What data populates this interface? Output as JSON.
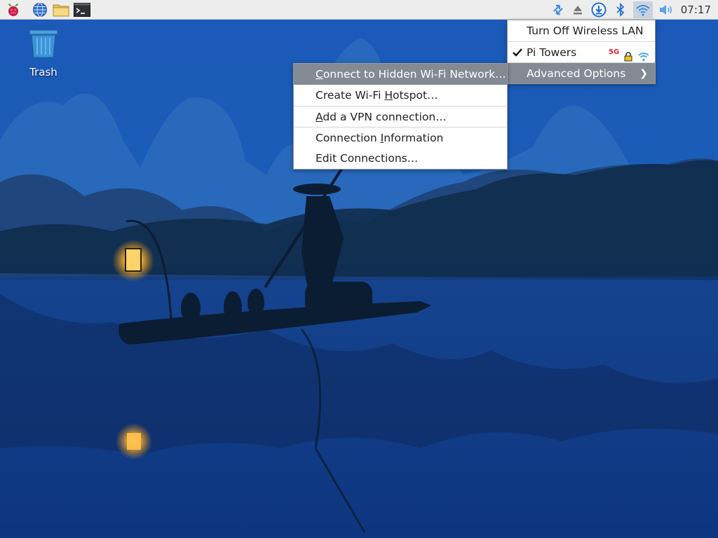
{
  "taskbar": {
    "launchers": [
      {
        "name": "raspberry-menu-icon"
      },
      {
        "name": "web-browser-icon"
      },
      {
        "name": "file-manager-icon"
      },
      {
        "name": "terminal-icon"
      }
    ],
    "tray": [
      {
        "name": "network-transfer-icon"
      },
      {
        "name": "eject-icon"
      },
      {
        "name": "updates-icon"
      },
      {
        "name": "bluetooth-icon"
      },
      {
        "name": "wifi-icon"
      },
      {
        "name": "volume-icon"
      }
    ],
    "clock": "07:17"
  },
  "desktop": {
    "trash_label": "Trash"
  },
  "network_menu": {
    "turn_off": "Turn Off Wireless LAN",
    "network": {
      "ssid": "Pi Towers",
      "band": "5G",
      "connected": true,
      "secured": true
    },
    "advanced": "Advanced Options"
  },
  "advanced_menu": {
    "items": [
      {
        "pre": "",
        "mn": "C",
        "post": "onnect to Hidden Wi-Fi Network…",
        "highlighted": true
      },
      {
        "pre": "Create Wi-Fi ",
        "mn": "H",
        "post": "otspot…"
      },
      {
        "pre": "",
        "mn": "A",
        "post": "dd a VPN connection…"
      },
      {
        "pre": "Connection ",
        "mn": "I",
        "post": "nformation"
      },
      {
        "pre": "Edit Connections…",
        "mn": "",
        "post": ""
      }
    ]
  },
  "colors": {
    "taskbar_bg": "#ededed",
    "menu_highlight": "#838a94",
    "band_5g": "#e8252f"
  }
}
